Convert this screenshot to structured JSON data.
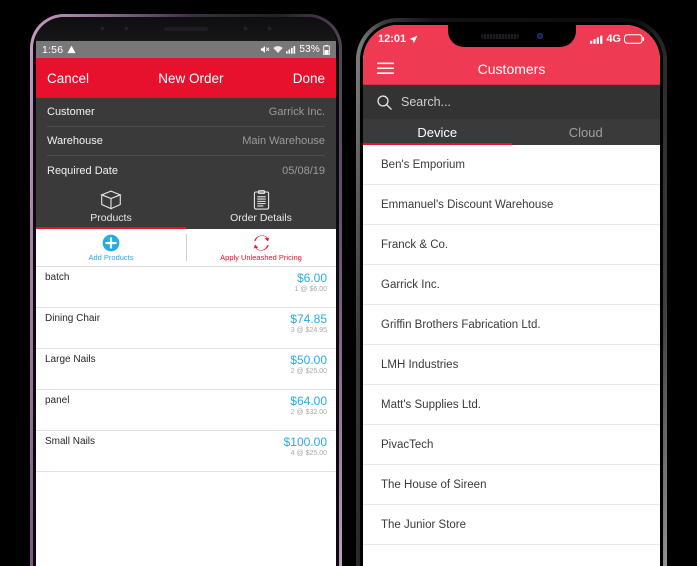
{
  "android": {
    "status": {
      "time": "1:56",
      "battery_percent": "53%",
      "icons": [
        "warning-triangle-icon",
        "mute-icon",
        "wifi-icon",
        "signal-icon",
        "battery-icon"
      ]
    },
    "navbar": {
      "left_label": "Cancel",
      "title": "New Order",
      "right_label": "Done"
    },
    "form": [
      {
        "label": "Customer",
        "value": "Garrick Inc."
      },
      {
        "label": "Warehouse",
        "value": "Main Warehouse"
      },
      {
        "label": "Required Date",
        "value": "05/08/19"
      }
    ],
    "tabs": [
      {
        "label": "Products",
        "icon": "box-icon",
        "active": true
      },
      {
        "label": "Order Details",
        "icon": "clipboard-icon",
        "active": false
      }
    ],
    "actions": [
      {
        "label": "Add Products",
        "icon": "plus-circle-icon",
        "color": "#29ABE2"
      },
      {
        "label": "Apply Unleashed Pricing",
        "icon": "sync-arrows-icon",
        "color": "#E8112D"
      }
    ],
    "products": [
      {
        "name": "batch",
        "total": "$6.00",
        "detail": "1 @ $6.00"
      },
      {
        "name": "Dining Chair",
        "total": "$74.85",
        "detail": "3 @ $24.95"
      },
      {
        "name": "Large Nails",
        "total": "$50.00",
        "detail": "2 @ $25.00"
      },
      {
        "name": "panel",
        "total": "$64.00",
        "detail": "2 @ $32.00"
      },
      {
        "name": "Small Nails",
        "total": "$100.00",
        "detail": "4 @ $25.00"
      }
    ]
  },
  "iphone": {
    "status": {
      "time": "12:01",
      "network": "4G",
      "icons": [
        "location-arrow-icon",
        "signal-icon",
        "battery-icon"
      ]
    },
    "navbar": {
      "menu_icon": "hamburger-menu-icon",
      "title": "Customers"
    },
    "search": {
      "placeholder": "Search...",
      "icon": "search-icon"
    },
    "tabs": [
      {
        "label": "Device",
        "active": true
      },
      {
        "label": "Cloud",
        "active": false
      }
    ],
    "customers": [
      "Ben's Emporium",
      "Emmanuel's Discount Warehouse",
      "Franck & Co.",
      "Garrick Inc.",
      "Griffin Brothers Fabrication Ltd.",
      "LMH Industries",
      "Matt's Supplies Ltd.",
      "PivacTech",
      "The House of Sireen",
      "The Junior Store"
    ]
  },
  "colors": {
    "android_red": "#E8112D",
    "iphone_red": "#EE3A52",
    "accent_blue": "#29ABE2",
    "dark_panel": "#3a3a3a"
  }
}
